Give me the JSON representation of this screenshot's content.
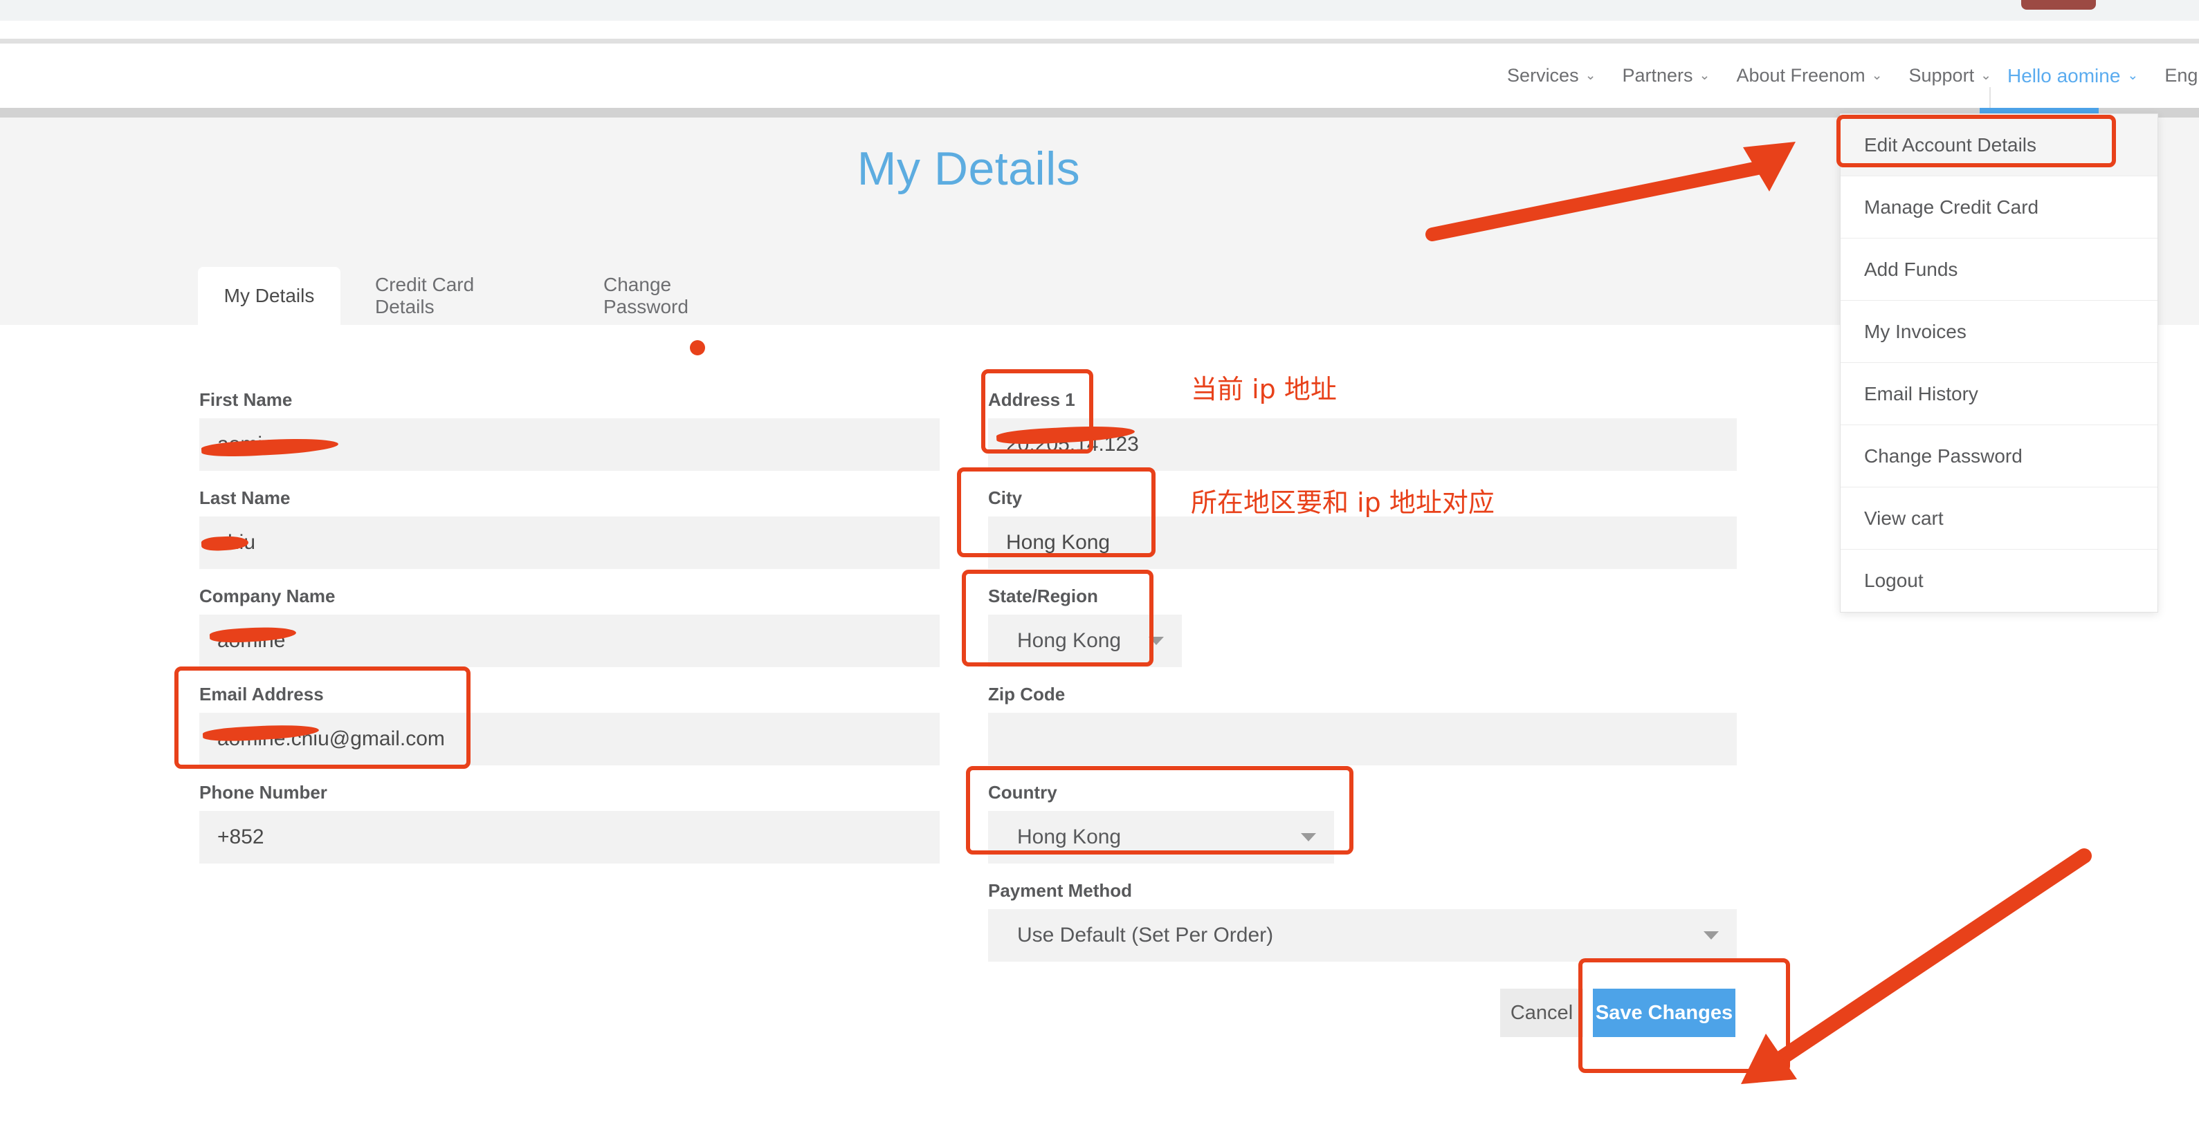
{
  "header": {
    "nav_items": [
      {
        "label": "Services",
        "has_caret": true
      },
      {
        "label": "Partners",
        "has_caret": true
      },
      {
        "label": "About Freenom",
        "has_caret": true
      },
      {
        "label": "Support",
        "has_caret": true
      }
    ],
    "account_label": "Hello aomine",
    "language_label": "Eng"
  },
  "page": {
    "title": "My Details"
  },
  "tabs": [
    {
      "label": "My Details",
      "active": true
    },
    {
      "label": "Credit Card Details",
      "active": false
    },
    {
      "label": "Change Password",
      "active": false
    }
  ],
  "form": {
    "left": [
      {
        "label": "First Name",
        "value": "aomine",
        "redacted": true,
        "type": "text"
      },
      {
        "label": "Last Name",
        "value": "chiu",
        "redacted": true,
        "type": "text"
      },
      {
        "label": "Company Name",
        "value": "aomine",
        "redacted": true,
        "type": "text"
      },
      {
        "label": "Email Address",
        "value": "aomine.chiu@gmail.com",
        "redacted": true,
        "type": "text"
      },
      {
        "label": "Phone Number",
        "value": "+852",
        "redacted": false,
        "type": "text"
      }
    ],
    "right": [
      {
        "label": "Address 1",
        "value": "20.205.14.123",
        "redacted": true,
        "type": "text"
      },
      {
        "label": "City",
        "value": "Hong Kong",
        "redacted": false,
        "type": "text"
      },
      {
        "label": "State/Region",
        "value": "Hong Kong",
        "redacted": false,
        "type": "select"
      },
      {
        "label": "Zip Code",
        "value": "",
        "redacted": false,
        "type": "text"
      },
      {
        "label": "Country",
        "value": "Hong Kong",
        "redacted": false,
        "type": "select"
      },
      {
        "label": "Payment Method",
        "value": "Use Default (Set Per Order)",
        "redacted": false,
        "type": "select"
      }
    ]
  },
  "actions": {
    "cancel_label": "Cancel",
    "save_label": "Save Changes"
  },
  "account_menu": {
    "items": [
      {
        "label": "Edit Account Details",
        "highlighted": true
      },
      {
        "label": "Manage Credit Card",
        "highlighted": false
      },
      {
        "label": "Add Funds",
        "highlighted": false
      },
      {
        "label": "My Invoices",
        "highlighted": false
      },
      {
        "label": "Email History",
        "highlighted": false
      },
      {
        "label": "Change Password",
        "highlighted": false
      },
      {
        "label": "View cart",
        "highlighted": false
      },
      {
        "label": "Logout",
        "highlighted": false
      }
    ]
  },
  "annotations": {
    "note_ip": "当前 ip 地址",
    "note_region": "所在地区要和 ip 地址对应",
    "accent_color": "#e8411a",
    "highlight_color": "#4da3e8"
  }
}
